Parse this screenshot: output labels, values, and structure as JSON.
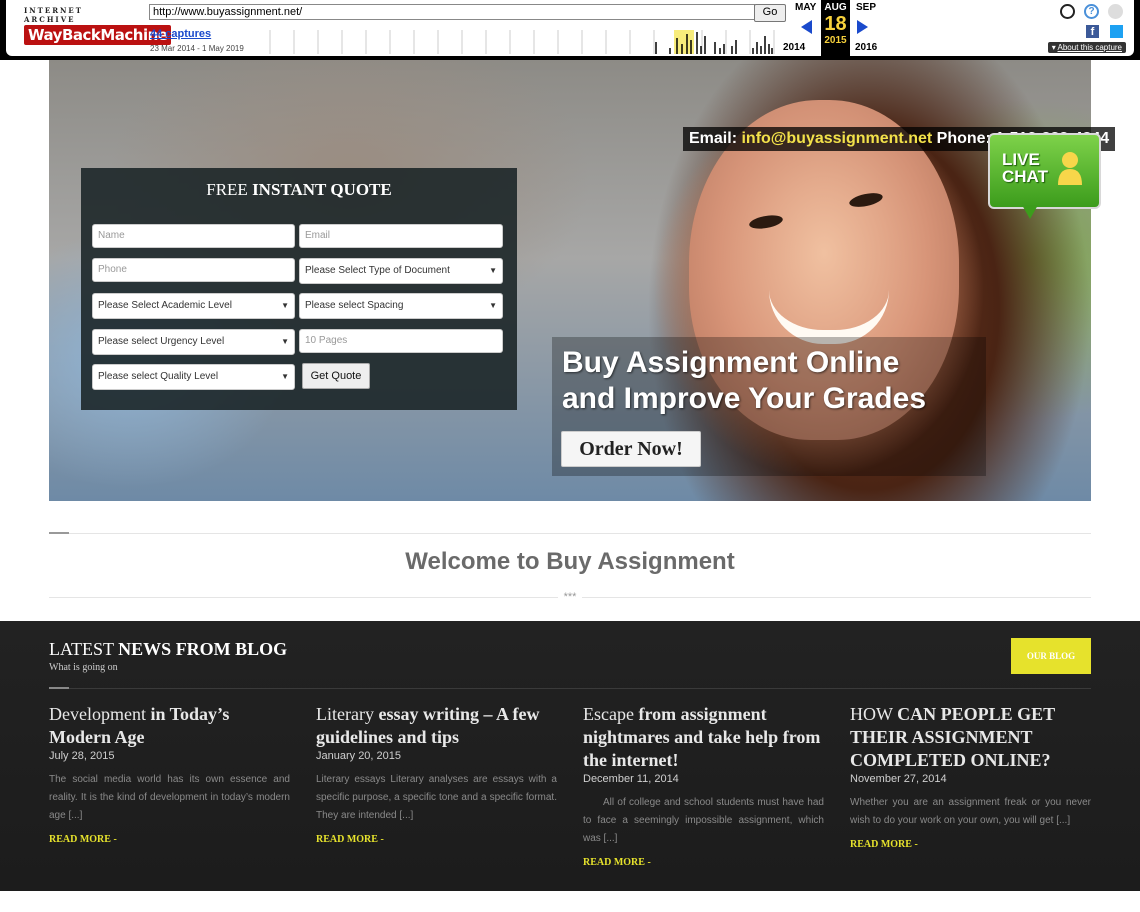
{
  "wayback": {
    "logo_top": "INTERNET ARCHIVE",
    "logo_main": "WayBackMachine",
    "url": "http://www.buyassignment.net/",
    "go_label": "Go",
    "captures": "44 captures",
    "range": "23 Mar 2014 - 1 May 2019",
    "prev_month": "MAY",
    "cur_month": "AUG",
    "next_month": "SEP",
    "cur_day": "18",
    "prev_year": "2014",
    "cur_year": "2015",
    "next_year": "2016",
    "about": "About this capture"
  },
  "hero": {
    "contact_email_label": "Email:",
    "contact_email": "info@buyassignment.net",
    "contact_phone_label": "Phone:",
    "contact_phone": "1-512-333-4344",
    "livechat_line1": "LIVE",
    "livechat_line2": "CHAT",
    "tagline_line1": "Buy Assignment Online",
    "tagline_line2": "and Improve Your Grades",
    "order_button": "Order Now!"
  },
  "quote": {
    "title_plain": "FREE",
    "title_bold": "INSTANT QUOTE",
    "name_placeholder": "Name",
    "email_placeholder": "Email",
    "phone_placeholder": "Phone",
    "document_select": "Please Select Type of Document",
    "academic_select": "Please Select Academic Level",
    "spacing_select": "Please select Spacing",
    "urgency_select": "Please select Urgency Level",
    "pages_placeholder": "10 Pages",
    "quality_select": "Please select Quality Level",
    "submit": "Get Quote"
  },
  "welcome": {
    "title": "Welcome to Buy Assignment",
    "divider": "***"
  },
  "blog": {
    "heading_plain": "LATEST",
    "heading_bold": "NEWS FROM BLOG",
    "subheading": "What is going on",
    "button": "OUR BLOG",
    "read_more": "READ MORE -",
    "posts": [
      {
        "title_plain": "Development",
        "title_bold": "in Today’s Modern Age",
        "date": "July 28, 2015",
        "excerpt": "The social media world has its own essence and reality. It is the kind of development in today’s modern age [...]"
      },
      {
        "title_plain": "Literary",
        "title_bold": "essay writing – A few guidelines and tips",
        "date": "January 20, 2015",
        "excerpt": "Literary essays Literary analyses are essays with a specific purpose, a specific tone and a specific format. They are intended [...]"
      },
      {
        "title_plain": "Escape",
        "title_bold": "from assignment nightmares and take help from the internet!",
        "date": "December 11, 2014",
        "excerpt": "All of college and school students must have had to face a seemingly impossible assignment, which was [...]"
      },
      {
        "title_plain": "HOW",
        "title_bold": "CAN PEOPLE GET THEIR ASSIGNMENT COMPLETED ONLINE?",
        "date": "November 27, 2014",
        "excerpt": "Whether you are an assignment freak or you never wish to do your work on your own, you will get [...]"
      }
    ]
  },
  "colors": {
    "accent_yellow": "#e6e22c",
    "blog_bg": "#1f1f1f",
    "livechat_green": "#3c9c1c"
  }
}
